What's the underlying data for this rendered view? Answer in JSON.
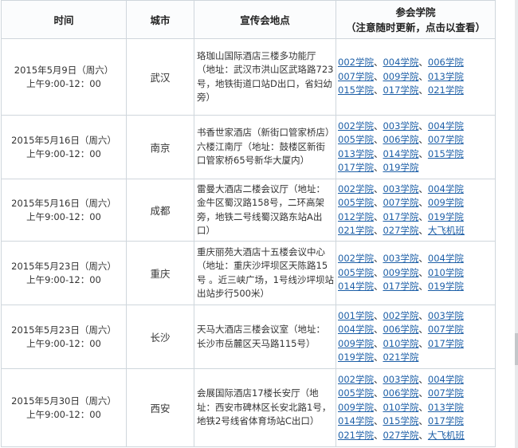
{
  "headers": {
    "time": "时间",
    "city": "城市",
    "venue": "宣传会地点",
    "colleges_line1": "参会学院",
    "colleges_line2": "（注意随时更新，点击以查看）"
  },
  "rows": [
    {
      "date": "2015年5月9日（周六）",
      "time": "上午9:00-12：00",
      "city": "武汉",
      "venue": "珞珈山国际酒店三楼多功能厅（地址：武汉市洪山区武珞路723号，地铁街道口站D出口，省妇幼旁）",
      "colleges": [
        [
          "002学院",
          "004学院",
          "006学院"
        ],
        [
          "007学院",
          "009学院",
          "013学院"
        ],
        [
          "015学院",
          "017学院",
          "021学院"
        ]
      ]
    },
    {
      "date": "2015年5月16日（周六）",
      "time": "上午9:00-12：00",
      "city": "南京",
      "venue": "书香世家酒店（新街口管家桥店）六楼江南厅（地址：鼓楼区新街口管家桥65号新华大厦内）",
      "colleges": [
        [
          "002学院",
          "003学院",
          "004学院"
        ],
        [
          "005学院",
          "006学院",
          "007学院"
        ],
        [
          "013学院",
          "014学院",
          "015学院"
        ],
        [
          "017学院",
          "019学院"
        ]
      ]
    },
    {
      "date": "2015年5月16日（周六）",
      "time": "上午9:00-12：00",
      "city": "成都",
      "venue": "雷曼大酒店二楼会议厅（地址：金牛区蜀汉路158号，二环高架旁，地铁二号线蜀汉路东站A出口）",
      "colleges": [
        [
          "002学院",
          "003学院",
          "004学院"
        ],
        [
          "005学院",
          "007学院",
          "009学院"
        ],
        [
          "012学院",
          "017学院",
          "019学院"
        ],
        [
          "021学院",
          "027学院",
          "大飞机班"
        ]
      ]
    },
    {
      "date": "2015年5月23日（周六）",
      "time": "上午9:00-12：00",
      "city": "重庆",
      "venue": "重庆丽苑大酒店十五楼会议中心（地址：重庆沙坪坝区天陈路15号 。近三峡广场，1号线沙坪坝站出站步行500米）",
      "colleges": [
        [
          "002学院",
          "003学院",
          "004学院"
        ],
        [
          "005学院",
          "009学院",
          "010学院"
        ],
        [
          "014学院",
          "017学院",
          "019学院"
        ]
      ]
    },
    {
      "date": "2015年5月23日（周六）",
      "time": "上午9:00-12：00",
      "city": "长沙",
      "venue": "天马大酒店三楼会议室（地址：长沙市岳麓区天马路115号）",
      "colleges": [
        [
          "001学院",
          "002学院",
          "003学院"
        ],
        [
          "004学院",
          "006学院",
          "007学院"
        ],
        [
          "009学院",
          "010学院",
          "017学院"
        ],
        [
          "019学院",
          "021学院"
        ]
      ]
    },
    {
      "date": "2015年5月30日（周六）",
      "time": "上午9:00-12：00",
      "city": "西安",
      "venue": "会展国际酒店17楼长安厅（地址：西安市碑林区长安北路1号，地铁2号线省体育场站C出口）",
      "colleges": [
        [
          "002学院",
          "003学院",
          "004学院"
        ],
        [
          "005学院",
          "006学院",
          "007学院"
        ],
        [
          "009学院",
          "010学院",
          "013学院"
        ],
        [
          "014学院",
          "015学院",
          "017学院"
        ],
        [
          "021学院",
          "027学院",
          "大飞机班"
        ]
      ]
    }
  ],
  "colors": {
    "link": "#1d5fa7",
    "border": "#cfd6dc",
    "text": "#333333"
  }
}
